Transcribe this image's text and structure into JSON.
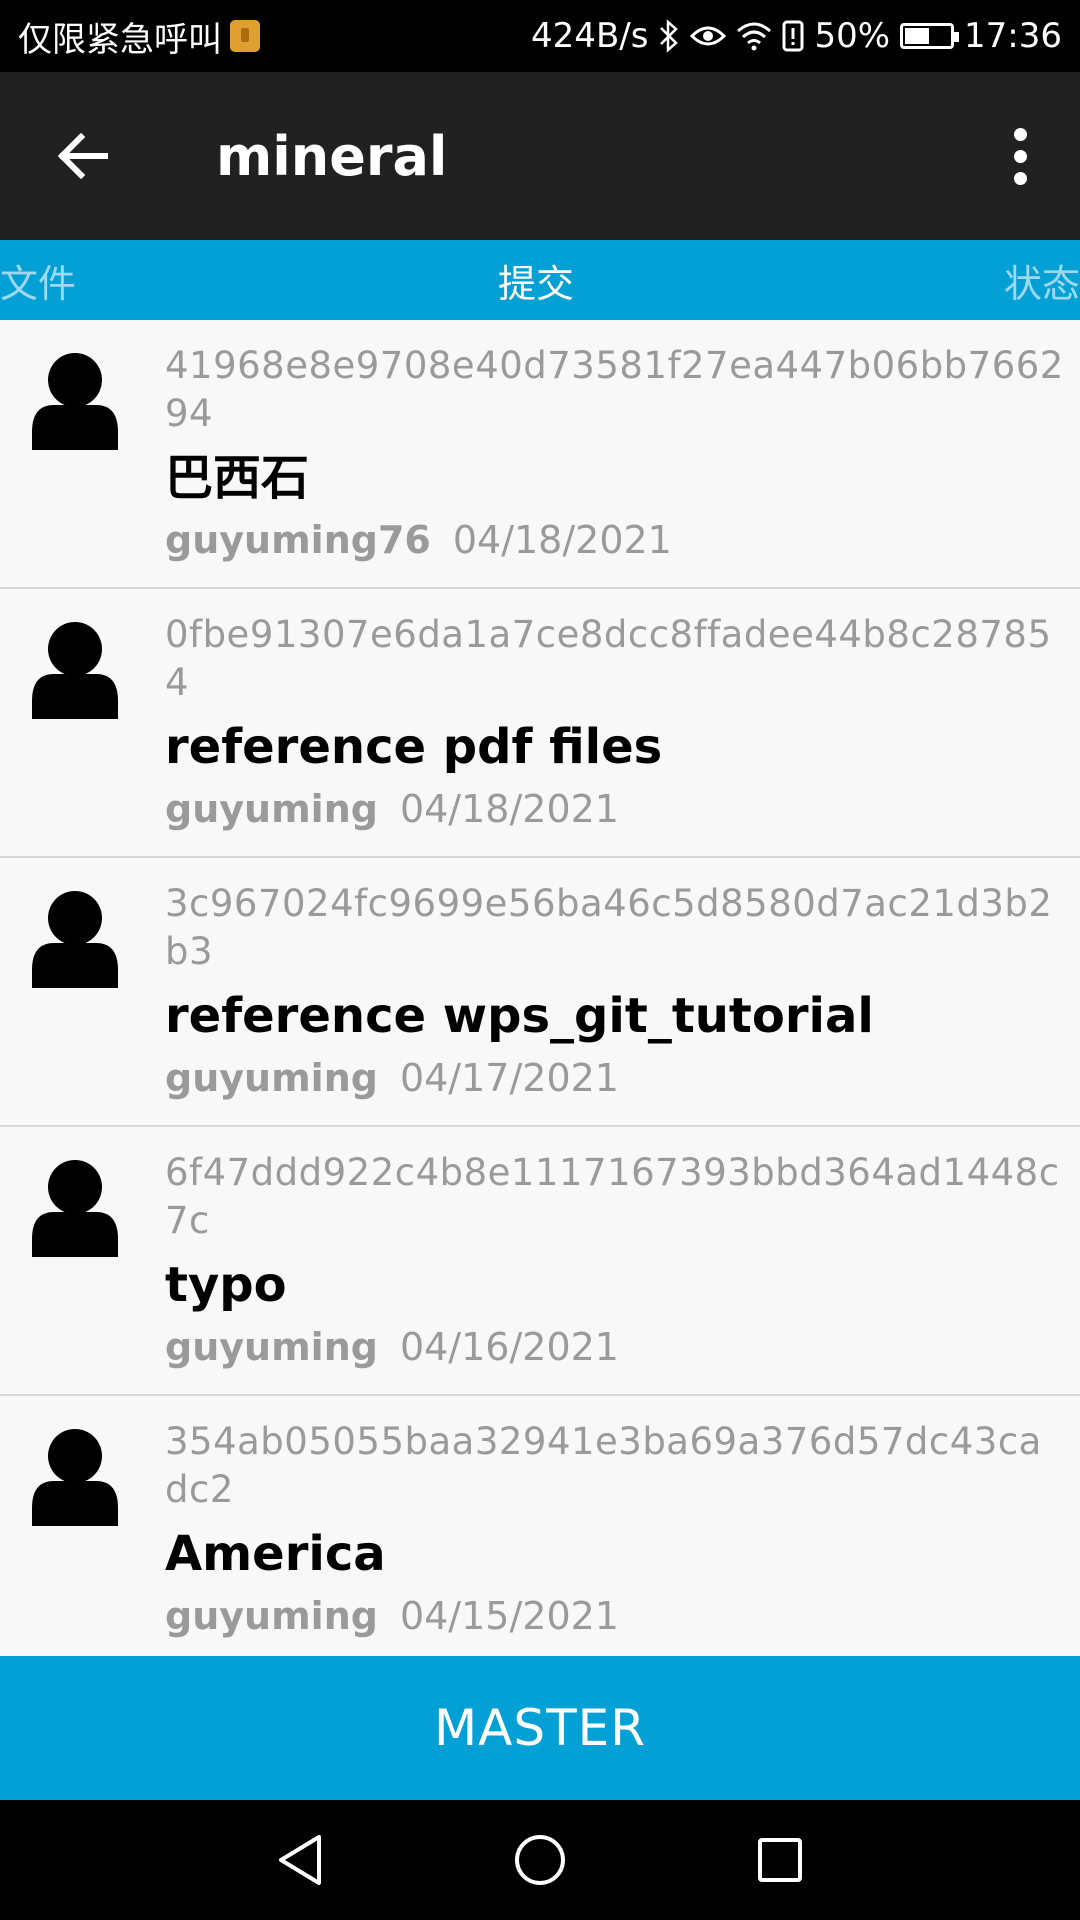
{
  "status_bar": {
    "emergency_text": "仅限紧急呼叫",
    "network_speed": "424B/s",
    "battery": "50%",
    "time": "17:36",
    "icons": [
      "sim-icon",
      "bluetooth-icon",
      "eye-icon",
      "wifi-icon",
      "alert-icon",
      "battery-icon"
    ]
  },
  "app_bar": {
    "title": "mineral",
    "back_icon": "arrow-left-icon",
    "overflow_icon": "more-vert-icon"
  },
  "tabs": [
    {
      "label": "文件",
      "active": false
    },
    {
      "label": "提交",
      "active": true
    },
    {
      "label": "状态",
      "active": false
    }
  ],
  "commits": [
    {
      "sha": "41968e8e9708e40d73581f27ea447b06bb766294",
      "message": "巴西石",
      "author": "guyuming76",
      "date": "04/18/2021"
    },
    {
      "sha": "0fbe91307e6da1a7ce8dcc8ffadee44b8c287854",
      "message": "reference pdf files",
      "author": "guyuming",
      "date": "04/18/2021"
    },
    {
      "sha": "3c967024fc9699e56ba46c5d8580d7ac21d3b2b3",
      "message": "reference wps_git_tutorial",
      "author": "guyuming",
      "date": "04/17/2021"
    },
    {
      "sha": "6f47ddd922c4b8e1117167393bbd364ad1448c7c",
      "message": "typo",
      "author": "guyuming",
      "date": "04/16/2021"
    },
    {
      "sha": "354ab05055baa32941e3ba69a376d57dc43cadc2",
      "message": "America",
      "author": "guyuming",
      "date": "04/15/2021"
    }
  ],
  "branch_bar": {
    "label": "MASTER"
  },
  "colors": {
    "accent": "#03a0d6",
    "app_bar": "#212121",
    "list_bg": "#f8f8f8",
    "secondary_text": "#9a9a9a"
  }
}
